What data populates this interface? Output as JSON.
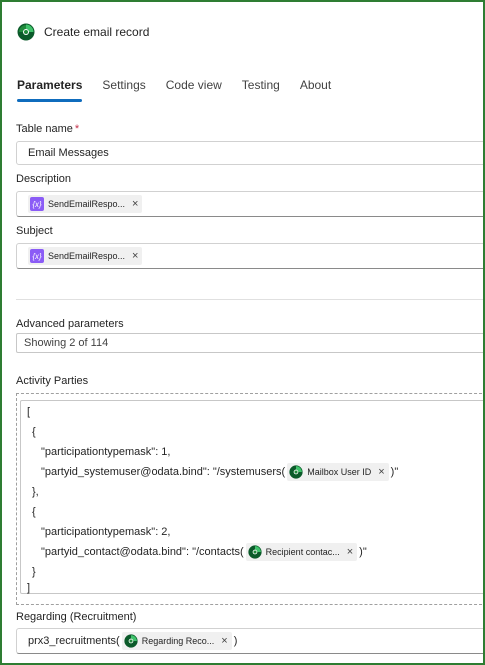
{
  "header": {
    "title": "Create email record",
    "icon": "dataverse-icon"
  },
  "tabs": [
    {
      "label": "Parameters",
      "active": true
    },
    {
      "label": "Settings",
      "active": false
    },
    {
      "label": "Code view",
      "active": false
    },
    {
      "label": "Testing",
      "active": false
    },
    {
      "label": "About",
      "active": false
    }
  ],
  "table_name": {
    "label": "Table name",
    "required_mark": "*",
    "value": "Email Messages"
  },
  "description": {
    "label": "Description",
    "token": "SendEmailRespo..."
  },
  "subject": {
    "label": "Subject",
    "token": "SendEmailRespo..."
  },
  "advanced": {
    "label": "Advanced parameters",
    "value": "Showing 2 of 114"
  },
  "activity_parties": {
    "label": "Activity Parties",
    "lines": {
      "l1": "[",
      "l2": "{",
      "l3": "\"participationtypemask\": 1,",
      "l4_prefix": "\"partyid_systemuser@odata.bind\": \"/systemusers(",
      "l4_token": "Mailbox User ID",
      "l4_suffix": ")\"",
      "l5": "},",
      "l6": "{",
      "l7": "\"participationtypemask\": 2,",
      "l8_prefix": "\"partyid_contact@odata.bind\": \"/contacts(",
      "l8_token": "Recipient contac...",
      "l8_suffix": ")\"",
      "l9": "}",
      "l10": "]"
    }
  },
  "regarding": {
    "label": "Regarding (Recruitment)",
    "prefix": "prx3_recruitments(",
    "token": "Regarding Reco...",
    "suffix": ")"
  },
  "icons": {
    "remove": "×",
    "expression": "{x}"
  },
  "colors": {
    "accent": "#0f6cbd",
    "required": "#c4314b",
    "expression_token": "#8b5cf6",
    "frame": "#2e7d32",
    "dataverse_green": "#1f8a3b"
  }
}
